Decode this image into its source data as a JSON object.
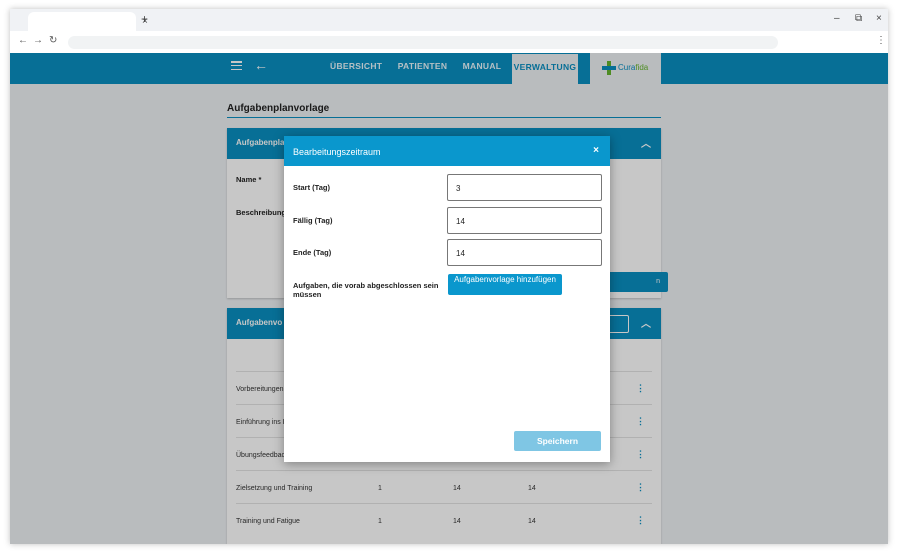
{
  "browser": {
    "tab_close": "×",
    "tab_new": "+",
    "minimize": "–",
    "restore": "⧉",
    "close": "×",
    "back": "←",
    "forward": "→",
    "reload": "↻",
    "menu": "⋮"
  },
  "appbar": {
    "back_icon": "←",
    "nav": [
      {
        "label": "ÜBERSICHT"
      },
      {
        "label": "PATIENTEN"
      },
      {
        "label": "MANUAL"
      },
      {
        "label": "VERWALTUNG"
      }
    ],
    "logo": {
      "part1": "Cura",
      "part2": "fida"
    }
  },
  "page": {
    "title": "Aufgabenplanvorlage",
    "card1": {
      "title": "Aufgabenpla",
      "name_label": "Name *",
      "desc_label": "Beschreibung",
      "button_tail": "n"
    },
    "card2": {
      "title": "Aufgabenvo",
      "rows": [
        {
          "name": "Vorbereitungen",
          "c1": "",
          "c2": "",
          "c3": ""
        },
        {
          "name": "Einführung ins K",
          "c1": "",
          "c2": "",
          "c3": ""
        },
        {
          "name": "Übungsfeedbac",
          "c1": "",
          "c2": "",
          "c3": ""
        },
        {
          "name": "Zielsetzung und Training",
          "c1": "1",
          "c2": "14",
          "c3": "14"
        },
        {
          "name": "Training und Fatigue",
          "c1": "1",
          "c2": "14",
          "c3": "14"
        }
      ]
    }
  },
  "dialog": {
    "title": "Bearbeitungszeitraum",
    "close_icon": "×",
    "fields": [
      {
        "label": "Start (Tag)",
        "value": "3"
      },
      {
        "label": "Fällig (Tag)",
        "value": "14"
      },
      {
        "label": "Ende (Tag)",
        "value": "14"
      }
    ],
    "prereq_label": "Aufgaben, die vorab abgeschlossen sein müssen",
    "add_button": "Aufgabenvorlage hinzufügen",
    "save_button": "Speichern"
  },
  "colors": {
    "primary": "#0a8fc1",
    "dialog_header": "#0a97cd",
    "save_disabled": "#7fc6e4",
    "logo_green": "#64b42d"
  }
}
